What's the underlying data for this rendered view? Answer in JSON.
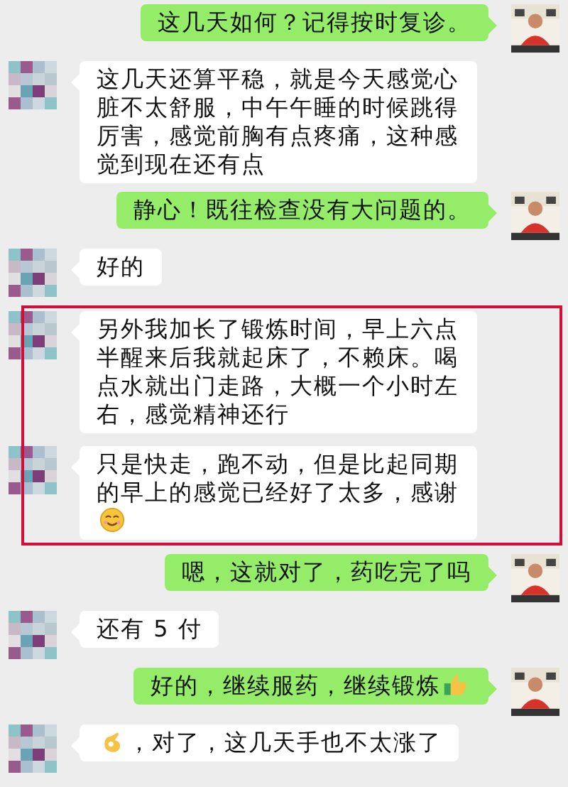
{
  "messages": [
    {
      "kind": "message",
      "sent": true,
      "parts": [
        {
          "kind": "text",
          "text": "这几天如何？记得按时复诊。"
        }
      ]
    },
    {
      "kind": "message",
      "sent": false,
      "parts": [
        {
          "kind": "text",
          "text": "这几天还算平稳，就是今天感觉心脏不太舒服，中午午睡的时候跳得厉害，感觉前胸有点疼痛，这种感觉到现在还有点"
        }
      ]
    },
    {
      "kind": "message",
      "sent": true,
      "parts": [
        {
          "kind": "text",
          "text": "静心！既往检查没有大问题的。"
        }
      ]
    },
    {
      "kind": "message",
      "sent": false,
      "parts": [
        {
          "kind": "text",
          "text": "好的"
        }
      ]
    },
    {
      "kind": "highlight",
      "messages": [
        {
          "kind": "message",
          "sent": false,
          "parts": [
            {
              "kind": "text",
              "text": "另外我加长了锻炼时间，早上六点半醒来后我就起床了，不赖床。喝点水就出门走路，大概一个小时左右，感觉精神还行"
            }
          ]
        },
        {
          "kind": "message",
          "sent": false,
          "parts": [
            {
              "kind": "text",
              "text": "只是快走，跑不动，但是比起同期的早上的感觉已经好了太多，感谢"
            },
            {
              "kind": "smile"
            }
          ]
        }
      ]
    },
    {
      "kind": "message",
      "sent": true,
      "parts": [
        {
          "kind": "text",
          "text": "嗯，这就对了，药吃完了吗"
        }
      ]
    },
    {
      "kind": "message",
      "sent": false,
      "parts": [
        {
          "kind": "text",
          "text": "还有 5 付"
        }
      ]
    },
    {
      "kind": "message",
      "sent": true,
      "parts": [
        {
          "kind": "text",
          "text": "好的，继续服药，继续锻炼"
        },
        {
          "kind": "thumbs-up"
        }
      ]
    },
    {
      "kind": "message",
      "sent": false,
      "parts": [
        {
          "kind": "ok-hand"
        },
        {
          "kind": "text",
          "text": "，对了，这几天手也不太涨了"
        }
      ]
    }
  ]
}
